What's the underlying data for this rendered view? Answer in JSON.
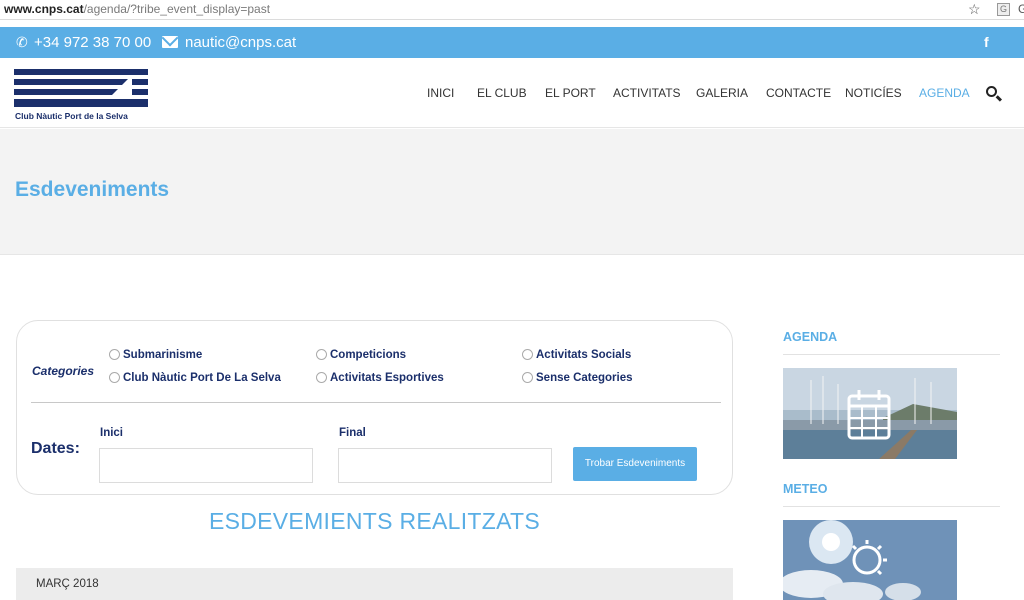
{
  "browser": {
    "url_domain": "www.cnps.cat",
    "url_path": "/agenda/?tribe_event_display=past"
  },
  "topbar": {
    "phone": "+34 972 38 70 00",
    "email": "nautic@cnps.cat",
    "social": "f"
  },
  "header": {
    "logo_name": "Club Nàutic Port de la Selva",
    "nav": [
      "INICI",
      "EL CLUB",
      "EL PORT",
      "ACTIVITATS",
      "GALERIA",
      "CONTACTE",
      "NOTICÍES",
      "AGENDA"
    ],
    "active_nav": "AGENDA"
  },
  "page": {
    "title": "Esdeveniments"
  },
  "filter": {
    "categories_label": "Categories",
    "options": [
      "Submarinisme",
      "Competicions",
      "Activitats Socials",
      "Club Nàutic Port De La Selva",
      "Activitats Esportives",
      "Sense Categories"
    ],
    "dates_label": "Dates:",
    "start_label": "Inici",
    "end_label": "Final",
    "find_button": "Trobar Esdeveniments"
  },
  "events": {
    "section_title": "ESDEVEMIENTS REALITZATS",
    "month": "MARÇ 2018"
  },
  "sidebar": {
    "agenda_title": "AGENDA",
    "meteo_title": "METEO"
  },
  "colors": {
    "accent": "#5aaee5",
    "navy": "#1b2f6b"
  }
}
